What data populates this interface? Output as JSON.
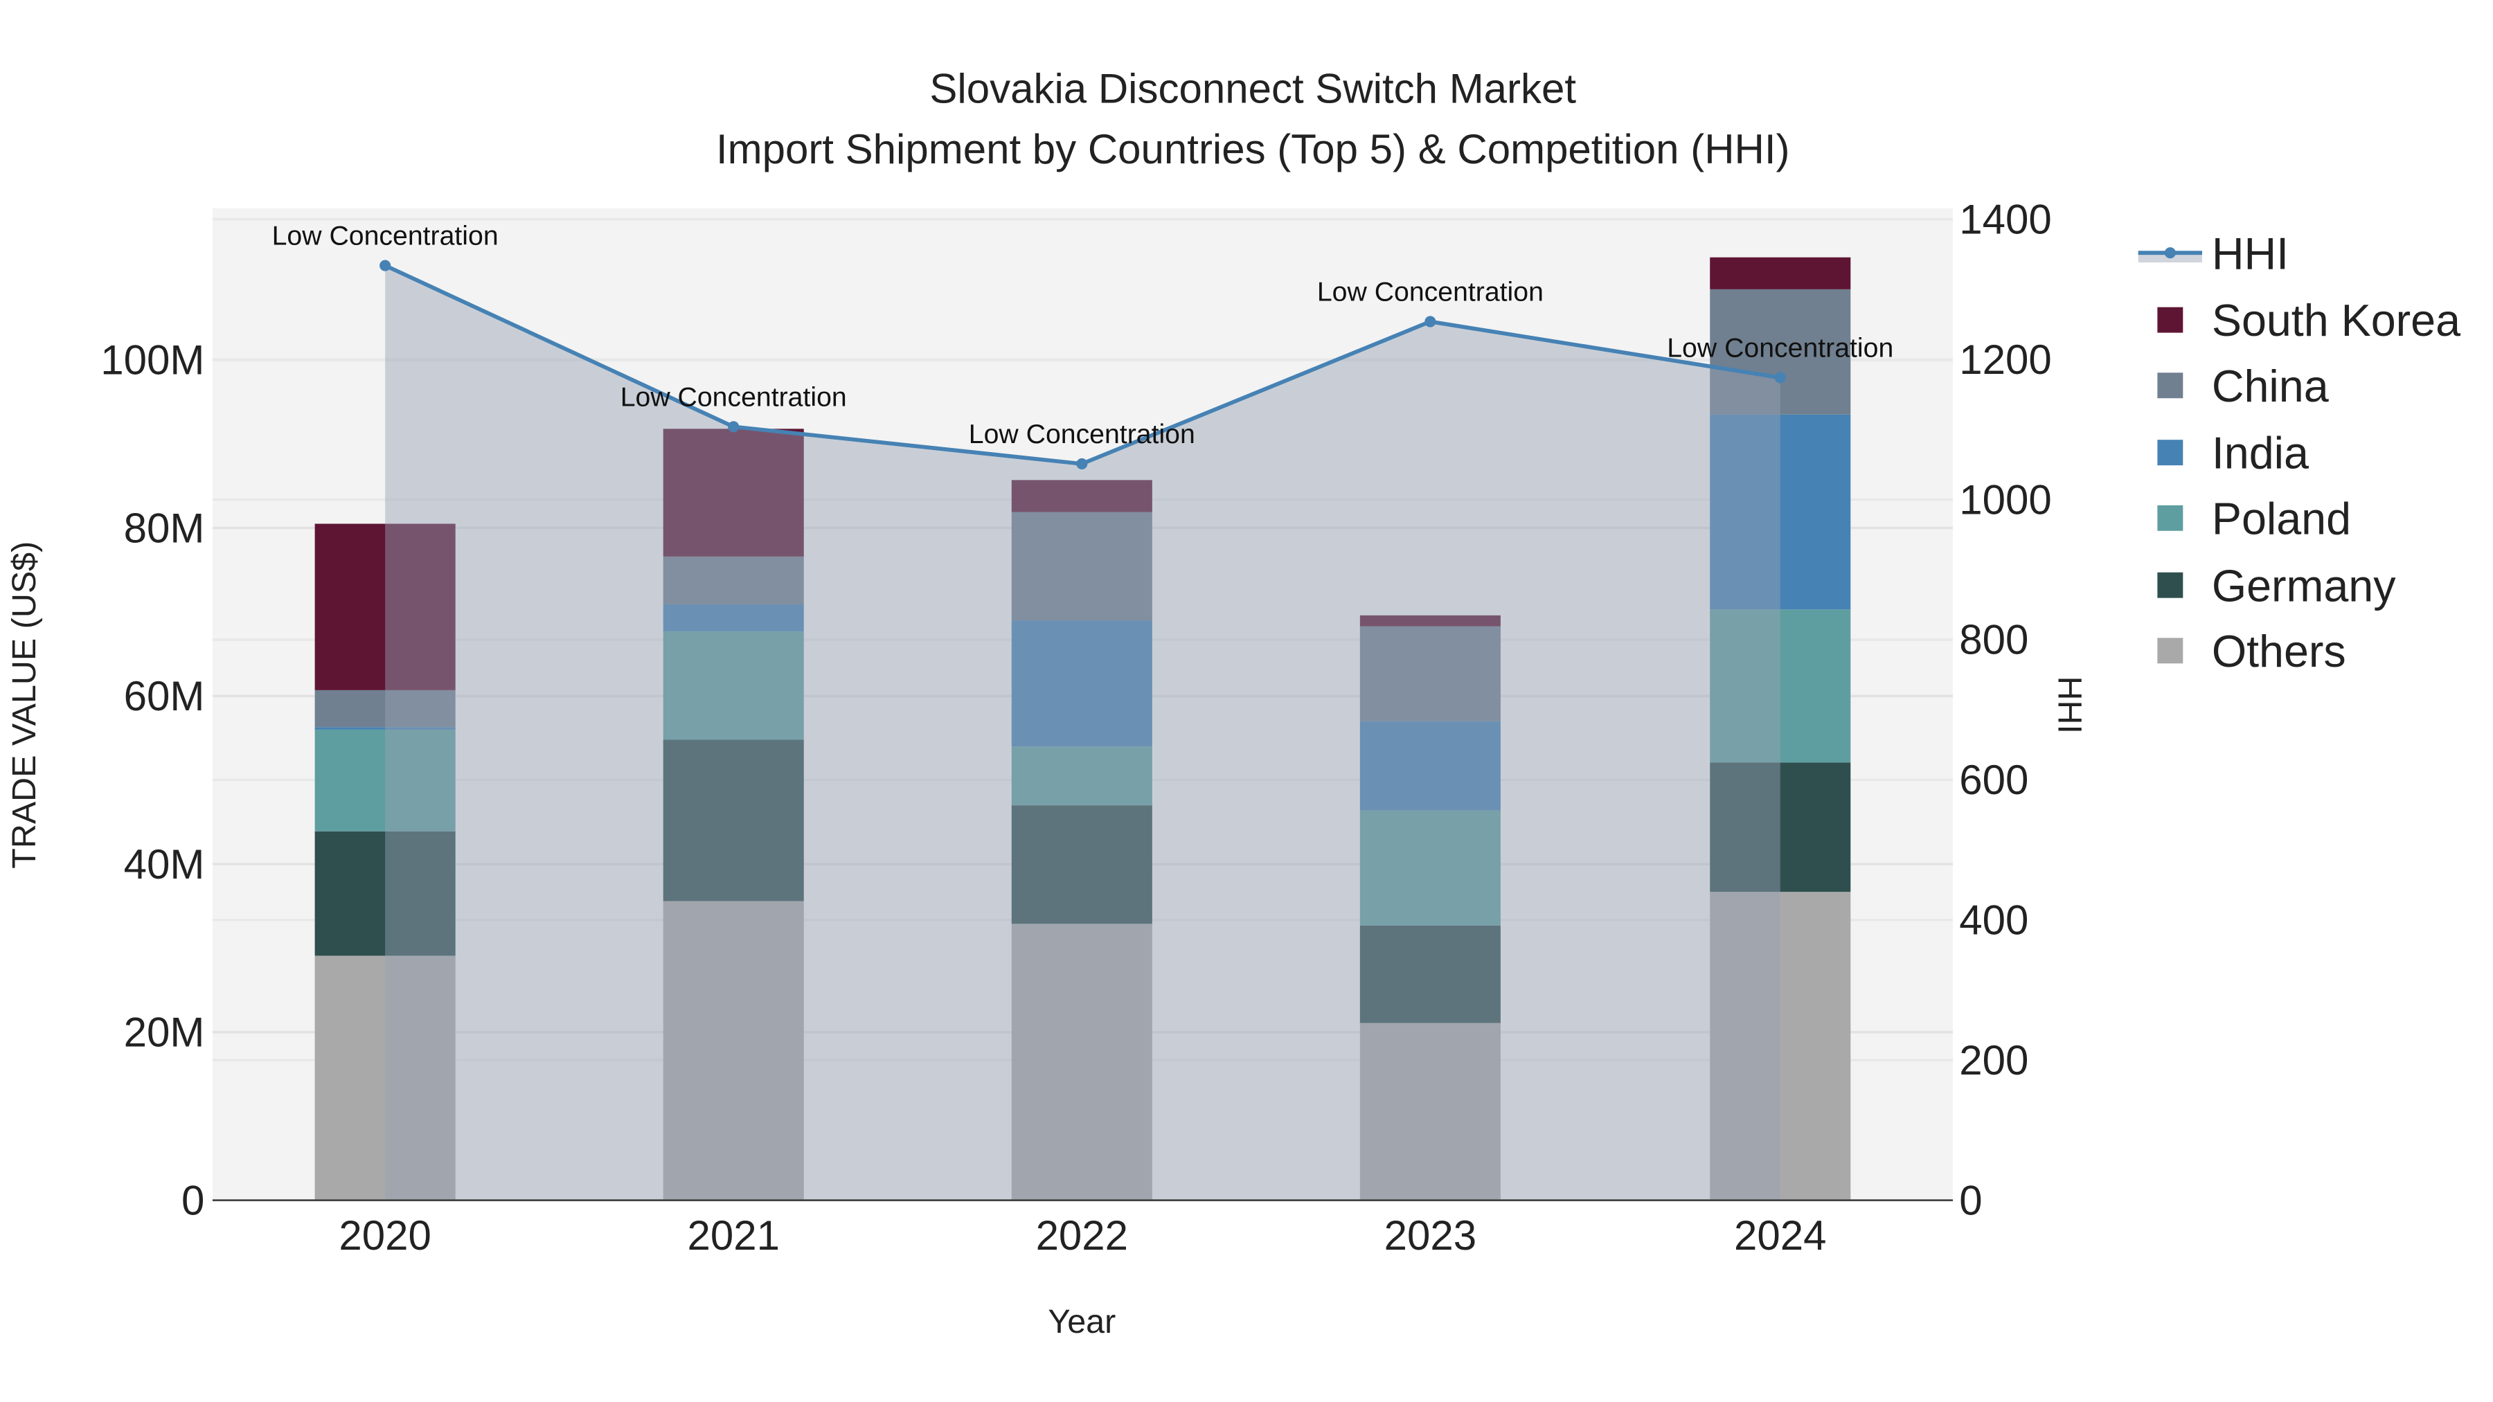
{
  "chart_data": {
    "type": "bar",
    "title": "Slovakia Disconnect Switch Market",
    "subtitle": "Import Shipment by Countries (Top 5) & Competition (HHI)",
    "xlabel": "Year",
    "ylabel": "TRADE VALUE (US$)",
    "y2label": "HHI",
    "categories": [
      "2020",
      "2021",
      "2022",
      "2023",
      "2024"
    ],
    "ylim": [
      0,
      117
    ],
    "y_ticks": [
      0,
      20,
      40,
      60,
      80,
      100
    ],
    "y_tick_labels": [
      "0",
      "20M",
      "40M",
      "60M",
      "80M",
      "100M"
    ],
    "y2lim": [
      0,
      1400
    ],
    "y2_ticks": [
      0,
      200,
      400,
      600,
      800,
      1000,
      1200,
      1400
    ],
    "y2_tick_labels": [
      "0",
      "200",
      "400",
      "600",
      "800",
      "1000",
      "1200",
      "1400"
    ],
    "series": [
      {
        "name": "Others",
        "color": "#a9a9a9",
        "values": [
          29.1,
          35.6,
          32.9,
          21.1,
          36.7
        ]
      },
      {
        "name": "Germany",
        "color": "#2f4f4f",
        "values": [
          14.8,
          19.2,
          14.1,
          11.6,
          15.4
        ]
      },
      {
        "name": "Poland",
        "color": "#5f9ea0",
        "values": [
          12.1,
          12.9,
          7.0,
          13.7,
          18.2
        ]
      },
      {
        "name": "India",
        "color": "#4682b4",
        "values": [
          0.3,
          3.2,
          15.0,
          10.6,
          23.2
        ]
      },
      {
        "name": "China",
        "color": "#708090",
        "values": [
          4.4,
          5.7,
          12.9,
          11.3,
          14.9
        ]
      },
      {
        "name": "South Korea",
        "color": "#5e1534",
        "values": [
          19.8,
          15.2,
          3.8,
          1.3,
          3.8
        ]
      }
    ],
    "line": {
      "name": "HHI",
      "color": "#4682b4",
      "values": [
        1334,
        1104,
        1051,
        1254,
        1174
      ]
    },
    "annotations": [
      "Low Concentration",
      "Low Concentration",
      "Low Concentration",
      "Low Concentration",
      "Low Concentration"
    ],
    "legend": [
      "HHI",
      "South Korea",
      "China",
      "India",
      "Poland",
      "Germany",
      "Others"
    ],
    "legend_position": "right",
    "grid": true
  }
}
